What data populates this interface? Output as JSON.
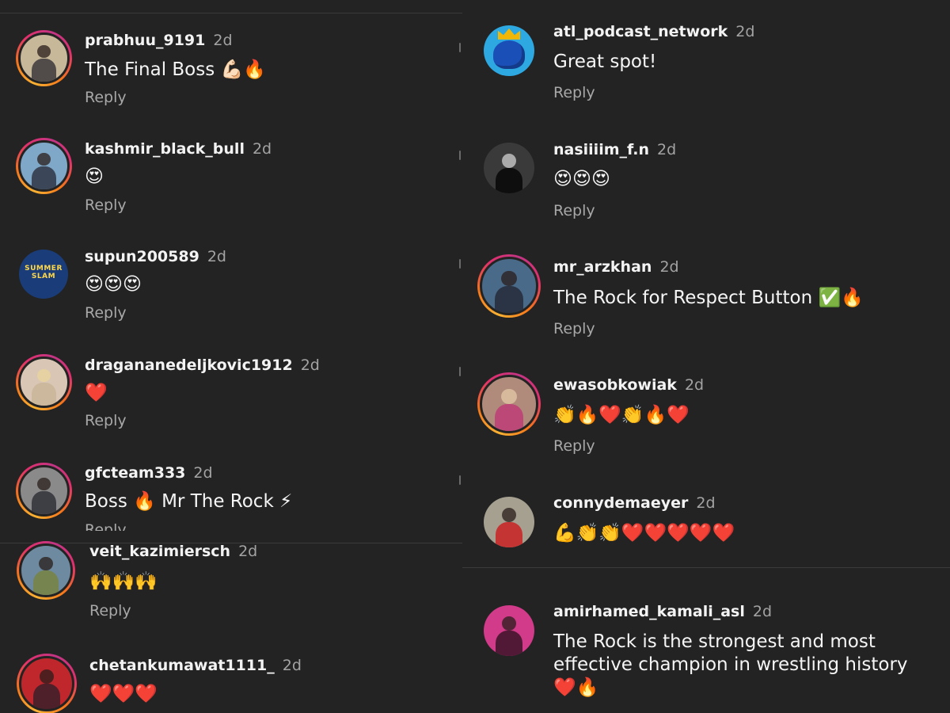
{
  "colors": {
    "background": "#232323",
    "divider": "#3a3a3a",
    "username": "#f3f3f3",
    "timestamp": "#a3a3a3",
    "reply": "#a8a8a8",
    "story_ring": [
      "#f9b233",
      "#f5761a",
      "#e1306c",
      "#c13584"
    ]
  },
  "reply_label": "Reply",
  "left_column": {
    "comments": [
      {
        "username": "prabhuu_9191",
        "time": "2d",
        "text": "The Final Boss 💪🏻🔥",
        "avatar": "person-standing-desert",
        "avatar_bg": "#c8b89a",
        "story_ring": true
      },
      {
        "username": "kashmir_black_bull",
        "time": "2d",
        "text": "😍",
        "avatar": "person-by-lake",
        "avatar_bg": "#7fa7c8",
        "story_ring": true
      },
      {
        "username": "supun200589",
        "time": "2d",
        "text": "😍😍😍",
        "avatar": "summerslam-logo",
        "avatar_bg": "#1a3d7a",
        "avatar_text": "SUMMER SLAM",
        "story_ring": false
      },
      {
        "username": "dragananedeljkovic1912",
        "time": "2d",
        "text": "❤️",
        "avatar": "blonde-woman",
        "avatar_bg": "#d9c6b4",
        "story_ring": true
      },
      {
        "username": "gfcteam333",
        "time": "2d",
        "text": "Boss 🔥 Mr The Rock ⚡",
        "avatar": "man-with-cap-bw",
        "avatar_bg": "#8a8a8a",
        "story_ring": true
      },
      {
        "username": "veit_kazimiersch",
        "time": "2d",
        "text": "🙌🙌🙌",
        "avatar": "man-holding-fish",
        "avatar_bg": "#6e8aa0",
        "story_ring": true
      },
      {
        "username": "chetankumawat1111_",
        "time": "2d",
        "text": "❤️❤️❤️",
        "avatar": "man-red-background",
        "avatar_bg": "#c0272d",
        "story_ring": true
      }
    ]
  },
  "right_column": {
    "comments": [
      {
        "username": "atl_podcast_network",
        "time": "2d",
        "text": "Great spot!",
        "avatar": "crowned-helmet-logo",
        "avatar_bg": "#2ea8e0",
        "story_ring": false
      },
      {
        "username": "nasiiiim_f.n",
        "time": "2d",
        "text": "😍😍😍",
        "avatar": "woman-black-white",
        "avatar_bg": "#3a3a3a",
        "story_ring": false
      },
      {
        "username": "mr_arzkhan",
        "time": "2d",
        "text": "The Rock for Respect Button ✅🔥",
        "avatar": "man-sitting-outdoors",
        "avatar_bg": "#4a6a8a",
        "story_ring": true
      },
      {
        "username": "ewasobkowiak",
        "time": "2d",
        "text": "👏🔥❤️👏🔥❤️",
        "avatar": "woman-glasses-scarf",
        "avatar_bg": "#b08a7a",
        "story_ring": true
      },
      {
        "username": "connydemaeyer",
        "time": "2d",
        "text": "💪👏👏❤️❤️❤️❤️❤️",
        "avatar": "woman-red-top-outdoors",
        "avatar_bg": "#a6a090",
        "story_ring": false
      },
      {
        "username": "amirhamed_kamali_asl",
        "time": "2d",
        "text": "The Rock is the strongest and most effective champion in wrestling history❤️🔥",
        "avatar": "man-pink-light",
        "avatar_bg": "#d23a8a",
        "story_ring": false
      }
    ]
  }
}
